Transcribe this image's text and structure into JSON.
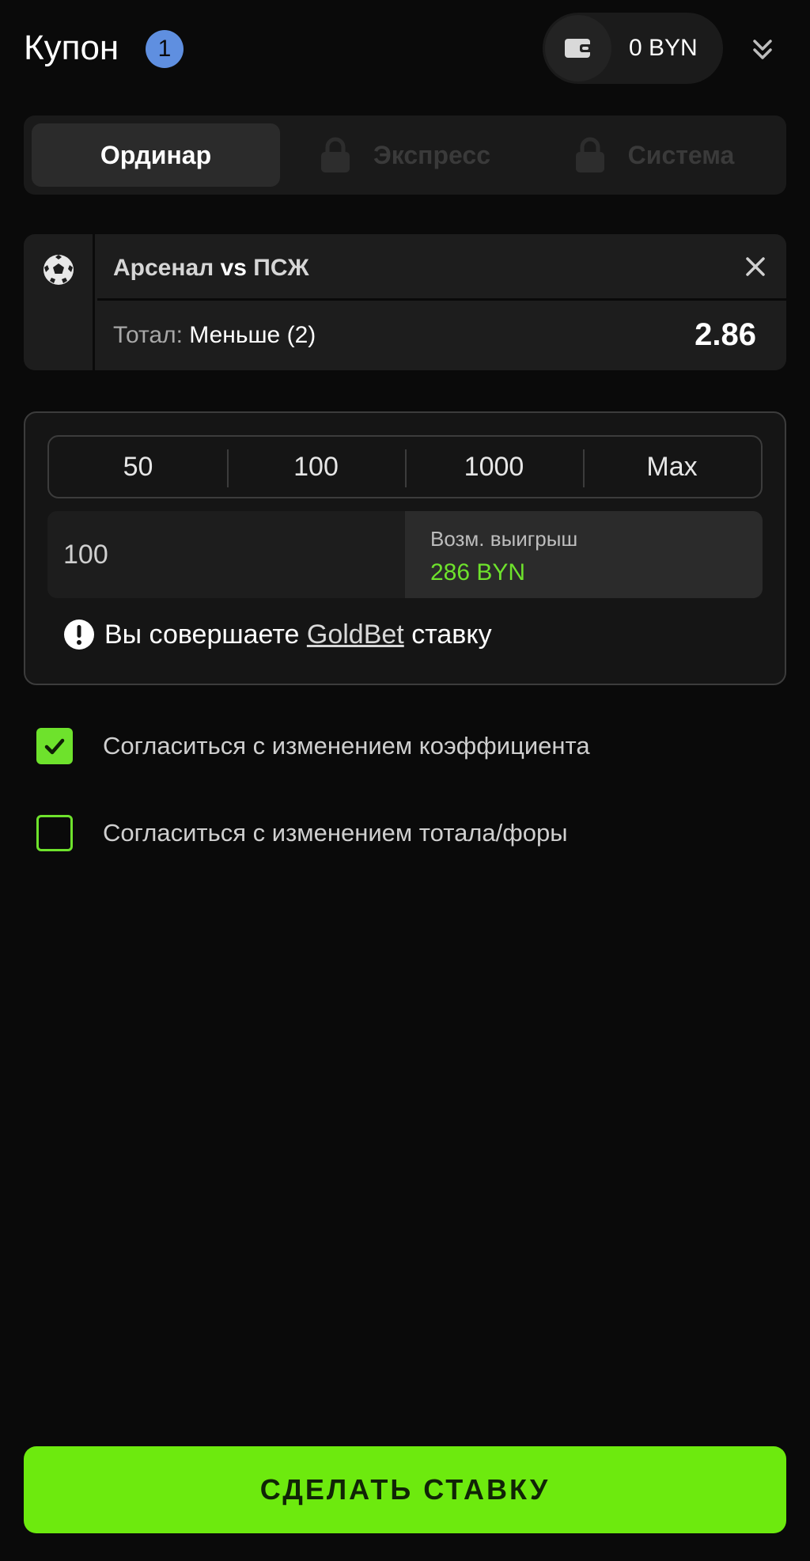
{
  "header": {
    "title": "Купон",
    "count": "1",
    "balance": "0 BYN",
    "icons": {
      "wallet": "wallet-icon",
      "collapse": "double-chevron-down-icon"
    }
  },
  "tabs": [
    {
      "label": "Ординар",
      "state": "active"
    },
    {
      "label": "Экспресс",
      "state": "locked",
      "icon": "lock-icon"
    },
    {
      "label": "Система",
      "state": "locked",
      "icon": "lock-icon"
    }
  ],
  "event": {
    "sport_icon": "soccer-ball-icon",
    "home": "Арсенал",
    "vs": "vs",
    "away": "ПСЖ",
    "market_label": "Тотал:",
    "market_value": "Меньше (2)",
    "odds": "2.86",
    "close_icon": "close-icon"
  },
  "stake": {
    "quick_amounts": [
      "50",
      "100",
      "1000",
      "Max"
    ],
    "amount_value": "100",
    "win_label": "Возм. выигрыш",
    "win_value": "286 BYN",
    "notice_prefix": "Вы совершаете",
    "notice_brand": "GoldBet",
    "notice_suffix": "ставку",
    "notice_icon": "exclamation-circle-icon"
  },
  "options": [
    {
      "label": "Согласиться с изменением коэффициента",
      "checked": true
    },
    {
      "label": "Согласиться с изменением тотала/форы",
      "checked": false
    }
  ],
  "submit_label": "СДЕЛАТЬ СТАВКУ",
  "colors": {
    "accent": "#6DEA0E",
    "badge": "#5F8FE0",
    "win": "#6EE22C",
    "background": "#0A0A0A"
  }
}
